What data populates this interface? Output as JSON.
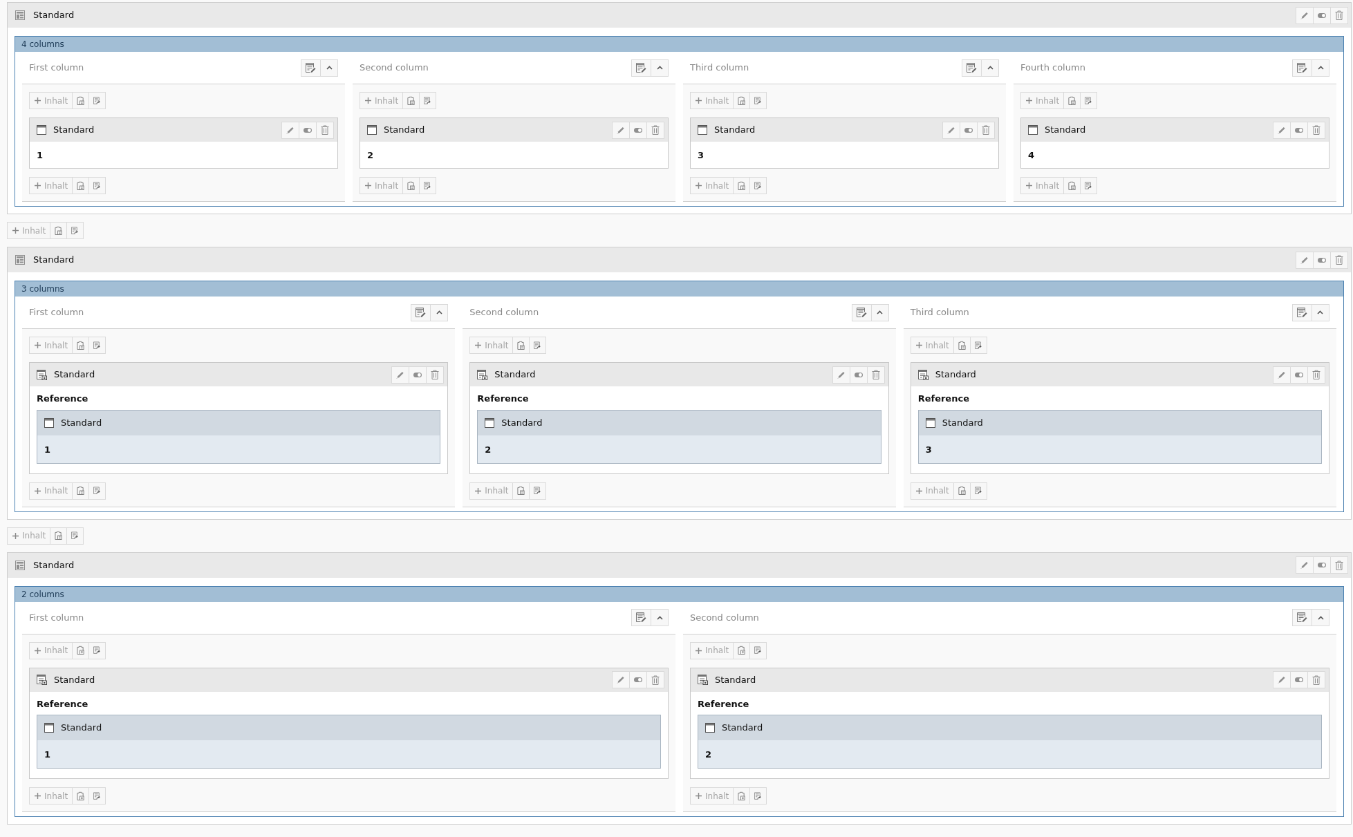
{
  "sections": [
    {
      "title": "Standard",
      "grid_label": "4 columns",
      "add_after": "Inhalt",
      "columns": [
        {
          "title": "First column",
          "add_top": "Inhalt",
          "add_bottom": "Inhalt",
          "elements": [
            {
              "kind": "text",
              "title": "Standard",
              "body": "1"
            }
          ]
        },
        {
          "title": "Second column",
          "add_top": "Inhalt",
          "add_bottom": "Inhalt",
          "elements": [
            {
              "kind": "text",
              "title": "Standard",
              "body": "2"
            }
          ]
        },
        {
          "title": "Third column",
          "add_top": "Inhalt",
          "add_bottom": "Inhalt",
          "elements": [
            {
              "kind": "text",
              "title": "Standard",
              "body": "3"
            }
          ]
        },
        {
          "title": "Fourth column",
          "add_top": "Inhalt",
          "add_bottom": "Inhalt",
          "elements": [
            {
              "kind": "text",
              "title": "Standard",
              "body": "4"
            }
          ]
        }
      ]
    },
    {
      "title": "Standard",
      "grid_label": "3 columns",
      "add_after": "Inhalt",
      "columns": [
        {
          "title": "First column",
          "add_top": "Inhalt",
          "add_bottom": "Inhalt",
          "elements": [
            {
              "kind": "reference",
              "title": "Standard",
              "body": "Reference",
              "reference": {
                "title": "Standard",
                "body": "1"
              }
            }
          ]
        },
        {
          "title": "Second column",
          "add_top": "Inhalt",
          "add_bottom": "Inhalt",
          "elements": [
            {
              "kind": "reference",
              "title": "Standard",
              "body": "Reference",
              "reference": {
                "title": "Standard",
                "body": "2"
              }
            }
          ]
        },
        {
          "title": "Third column",
          "add_top": "Inhalt",
          "add_bottom": "Inhalt",
          "elements": [
            {
              "kind": "reference",
              "title": "Standard",
              "body": "Reference",
              "reference": {
                "title": "Standard",
                "body": "3"
              }
            }
          ]
        }
      ]
    },
    {
      "title": "Standard",
      "grid_label": "2 columns",
      "columns": [
        {
          "title": "First column",
          "add_top": "Inhalt",
          "add_bottom": "Inhalt",
          "elements": [
            {
              "kind": "reference",
              "title": "Standard",
              "body": "Reference",
              "reference": {
                "title": "Standard",
                "body": "1"
              }
            }
          ]
        },
        {
          "title": "Second column",
          "add_top": "Inhalt",
          "add_bottom": "Inhalt",
          "elements": [
            {
              "kind": "reference",
              "title": "Standard",
              "body": "Reference",
              "reference": {
                "title": "Standard",
                "body": "2"
              }
            }
          ]
        }
      ]
    }
  ]
}
